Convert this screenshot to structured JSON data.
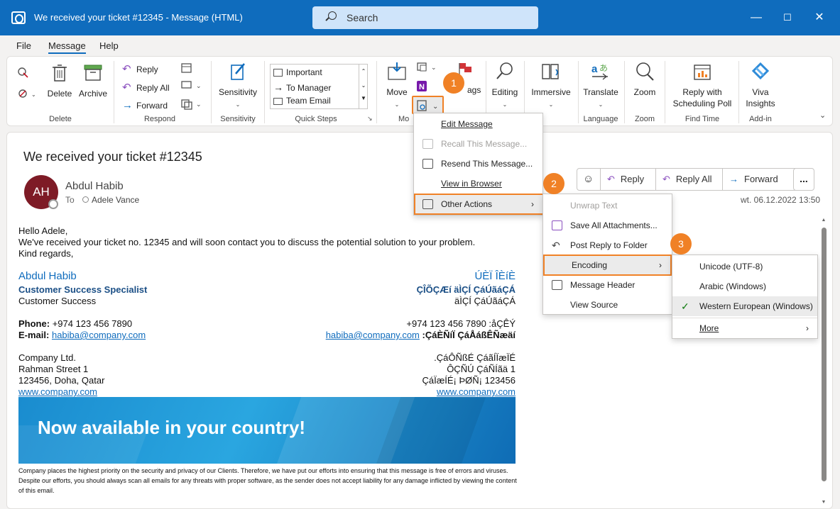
{
  "window": {
    "title": "We received your ticket #12345  -  Message (HTML)",
    "search_placeholder": "Search"
  },
  "menu": {
    "file": "File",
    "message": "Message",
    "help": "Help"
  },
  "ribbon": {
    "delete_group": {
      "label": "Delete",
      "delete": "Delete",
      "archive": "Archive"
    },
    "respond_group": {
      "label": "Respond",
      "reply": "Reply",
      "reply_all": "Reply All",
      "forward": "Forward"
    },
    "sensitivity_group": {
      "label": "Sensitivity",
      "button": "Sensitivity"
    },
    "quick_steps": {
      "label": "Quick Steps",
      "items": [
        "Important",
        "To Manager",
        "Team Email"
      ]
    },
    "move_group": {
      "label": "Mo",
      "move": "Move",
      "tags": "ags"
    },
    "editing": "Editing",
    "immersive": "Immersive",
    "language_group": {
      "label": "Language",
      "translate": "Translate"
    },
    "zoom_group": {
      "label": "Zoom",
      "zoom": "Zoom"
    },
    "find_time_group": {
      "label": "Find Time",
      "reply_poll_1": "Reply with",
      "reply_poll_2": "Scheduling Poll"
    },
    "addin_group": {
      "label": "Add-in",
      "viva_1": "Viva",
      "viva_2": "Insights"
    }
  },
  "badges": [
    "1",
    "2",
    "3"
  ],
  "message": {
    "subject": "We received your ticket #12345",
    "avatar_initials": "AH",
    "sender": "Abdul Habib",
    "to_label": "To",
    "recipient": "Adele Vance",
    "date": "wt. 06.12.2022 13:50",
    "actions": {
      "reply": "Reply",
      "reply_all": "Reply All",
      "forward": "Forward",
      "more": "..."
    },
    "body": {
      "greeting": "Hello Adele,",
      "line1": "We've received your ticket no. 12345 and will soon contact you to discuss the potential solution to your problem.",
      "closing": "Kind regards,"
    },
    "signature": {
      "name": "Abdul Habib",
      "title": "Customer Success Specialist",
      "dept": "Customer Success",
      "name_rtl": "ÚÈÏ ÎÈíÈ",
      "title_rtl": "ÇÎÕÇÆí äÌÇÍ ÇáÚãáÇÁ",
      "dept_rtl": "äÌÇÍ ÇáÚãáÇÁ",
      "phone_label": "Phone:",
      "phone": "+974 123 456 7890",
      "phone_rtl": "+974 123 456 7890 :åÇÊÝ",
      "email_label": "E-mail:",
      "email": "habiba@company.com",
      "email_rtl_label": ":ÇáÈÑíÏ ÇáÅáßÊÑæäí",
      "company": "Company Ltd.",
      "street": "Rahman Street 1",
      "city": "123456, Doha, Qatar",
      "website": "www.company.com",
      "company_rtl": ".ÇáÔÑßÉ ÇáãÍÏæÏÉ",
      "street_rtl": "ÔÇÑÚ ÇáÑÍãä 1",
      "city_rtl": "ÇáÏæÍÉ¡ ÞØÑ¡ 123456"
    },
    "banner": "Now available in your country!",
    "disclaimer": "Company places the highest priority on the security and privacy of our Clients. Therefore, we have put our efforts into ensuring that this message is free of errors and viruses. Despite our efforts, you should always scan all emails for any threats with proper software, as the sender does not accept liability for any damage inflicted by viewing the content of this email."
  },
  "menu1": {
    "items": [
      "Edit Message",
      "Recall This Message...",
      "Resend This Message...",
      "View in Browser",
      "Other Actions"
    ]
  },
  "menu2": {
    "items": [
      "Unwrap Text",
      "Save All Attachments...",
      "Post Reply to Folder",
      "Encoding",
      "Message Header",
      "View Source"
    ]
  },
  "menu3": {
    "items": [
      "Unicode (UTF-8)",
      "Arabic (Windows)",
      "Western European (Windows)",
      "More"
    ]
  },
  "colors": {
    "title_bar": "#0f6cbd",
    "highlight": "#f08126",
    "avatar": "#7e1b26",
    "link": "#0f6cbd"
  }
}
